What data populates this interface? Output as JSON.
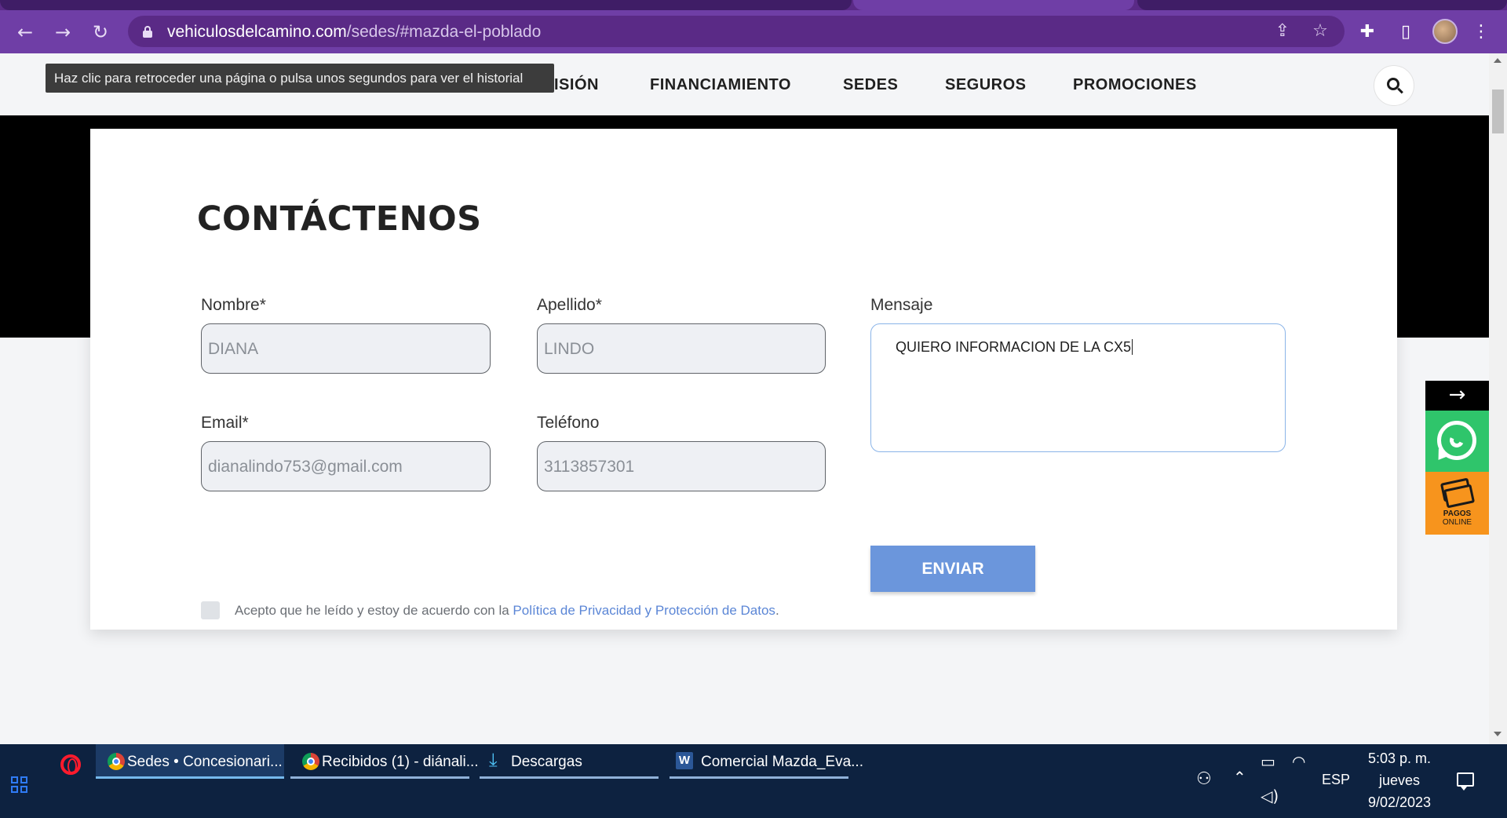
{
  "browser": {
    "url_host": "vehiculosdelcamino.com",
    "url_path": "/sedes/#mazda-el-poblado"
  },
  "tooltip": "Haz clic para retroceder una página o pulsa unos segundos para ver el historial",
  "site_nav": {
    "items": [
      "ISIÓN",
      "FINANCIAMIENTO",
      "SEDES",
      "SEGUROS",
      "PROMOCIONES"
    ]
  },
  "contact": {
    "title": "CONTÁCTENOS",
    "nombre_label": "Nombre*",
    "nombre_value": "DIANA",
    "apellido_label": "Apellido*",
    "apellido_value": "LINDO",
    "email_label": "Email*",
    "email_value": "dianalindo753@gmail.com",
    "telefono_label": "Teléfono",
    "telefono_value": "3113857301",
    "mensaje_label": "Mensaje",
    "mensaje_value": "QUIERO INFORMACION DE LA CX5",
    "send_label": "ENVIAR",
    "consent_text": "Acepto que he leído y estoy de acuerdo con la ",
    "consent_link": "Política de Privacidad y Protección de Datos",
    "consent_end": "."
  },
  "floating": {
    "arrow": "→",
    "pay_line1": "PAGOS",
    "pay_line2": "ONLINE"
  },
  "taskbar": {
    "tasks": [
      "Sedes • Concesionari...",
      "Recibidos (1) - diánali...",
      "Descargas",
      "Comercial Mazda_Eva..."
    ],
    "language": "ESP",
    "time": "5:03 p. m.",
    "day": "jueves",
    "date": "9/02/2023"
  },
  "colors": {
    "browser_frame": "#6f3ea6",
    "send_button": "#6b96dc",
    "whatsapp": "#2fc56b",
    "payments": "#f7941d",
    "taskbar": "#0d2240"
  }
}
